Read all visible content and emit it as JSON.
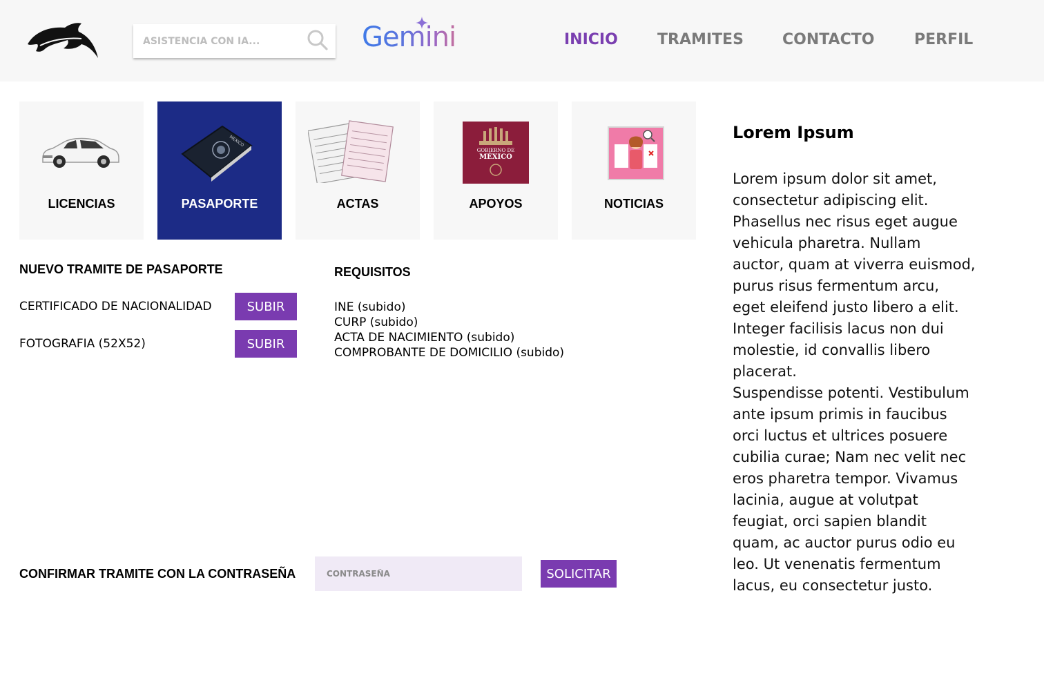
{
  "header": {
    "search_placeholder": "ASISTENCIA CON IA...",
    "assistant_brand": "Gemini",
    "nav": [
      {
        "label": "INICIO",
        "active": true
      },
      {
        "label": "TRAMITES",
        "active": false
      },
      {
        "label": "CONTACTO",
        "active": false
      },
      {
        "label": "PERFIL",
        "active": false
      }
    ],
    "icons": {
      "logo": "dolphin-logo-icon",
      "search": "search-icon",
      "star": "sparkle-icon"
    }
  },
  "categories": [
    {
      "label": "LICENCIAS",
      "icon": "car-icon",
      "selected": false
    },
    {
      "label": "PASAPORTE",
      "icon": "passport-icon",
      "selected": true
    },
    {
      "label": "ACTAS",
      "icon": "certificates-icon",
      "selected": false
    },
    {
      "label": "APOYOS",
      "icon": "gobierno-de-mexico-icon",
      "selected": false,
      "image_text": "GOBIERNO DE MÉXICO"
    },
    {
      "label": "NOTICIAS",
      "icon": "news-icon",
      "selected": false
    }
  ],
  "tramite": {
    "title": "NUEVO TRAMITE DE PASAPORTE",
    "uploads": [
      {
        "label": "CERTIFICADO DE NACIONALIDAD",
        "button": "SUBIR"
      },
      {
        "label": "FOTOGRAFIA (52X52)",
        "button": "SUBIR"
      }
    ]
  },
  "requisitos": {
    "title": "REQUISITOS",
    "items": [
      "INE (subido)",
      "CURP (subido)",
      "ACTA DE NACIMIENTO (subido)",
      "COMPROBANTE DE DOMICILIO (subido)"
    ]
  },
  "confirm": {
    "label": "CONFIRMAR TRAMITE CON LA CONTRASEÑA",
    "password_placeholder": "CONTRASEÑA",
    "submit": "SOLICITAR"
  },
  "sidebar": {
    "title": "Lorem Ipsum",
    "body": "Lorem ipsum dolor sit amet,\nconsectetur adipiscing elit.\nPhasellus nec risus eget augue\nvehicula pharetra. Nullam\nauctor, quam at viverra euismod,\npurus risus fermentum arcu,\neget eleifend justo libero a elit.\nInteger facilisis lacus non dui\nmolestie, id convallis libero\nplacerat.\nSuspendisse potenti. Vestibulum\nante ipsum primis in faucibus\norci luctus et ultrices posuere\ncubilia curae; Nam nec velit nec\neros pharetra tempor. Vivamus\nlacinia, augue at volutpat\nfeugiat, orci sapien blandit\nquam, ac auctor purus odio eu\nleo. Ut venenatis fermentum\nlacus, eu consectetur justo."
  },
  "colors": {
    "accent": "#7a3bb0",
    "selected_card": "#1c2b86",
    "header_bg": "#f7f7f7",
    "card_bg": "#f7f7f7",
    "input_bg": "#f0eaf6"
  }
}
